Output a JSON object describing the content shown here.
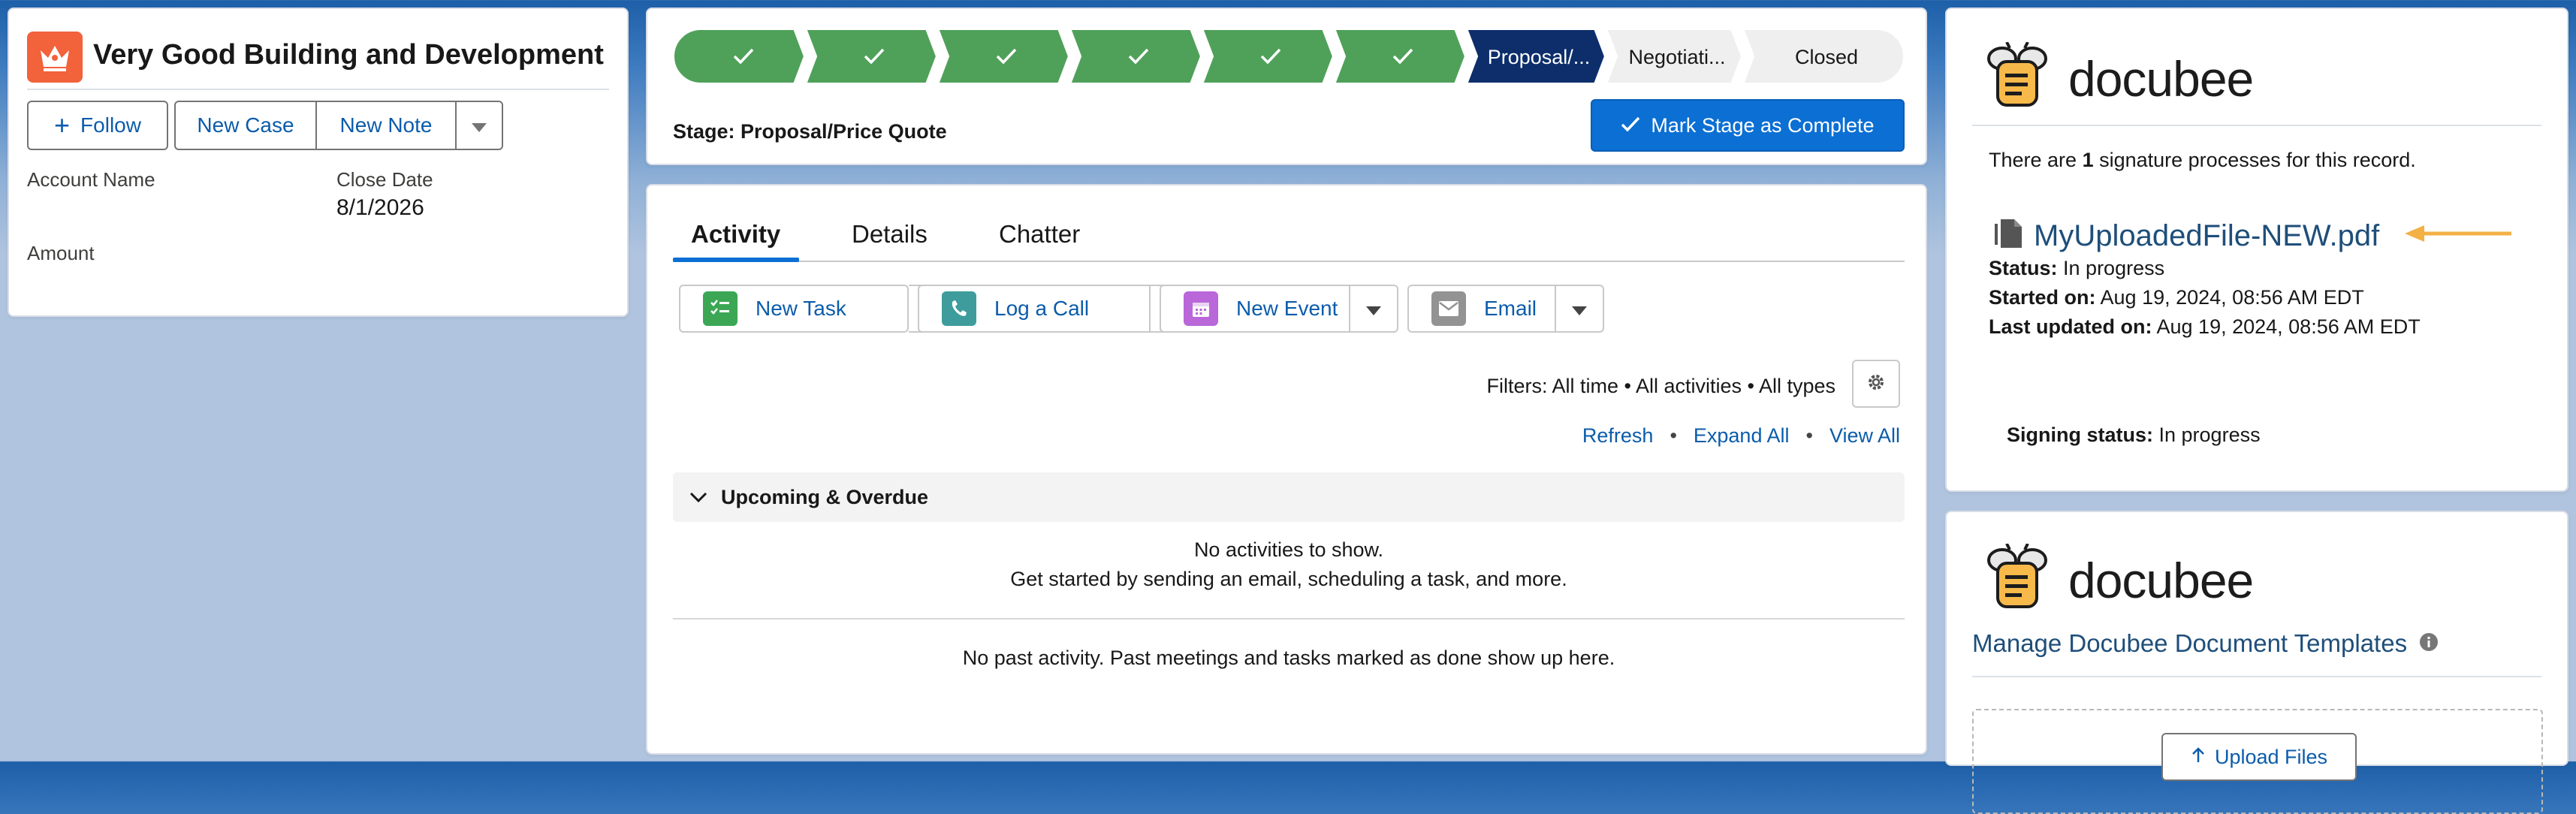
{
  "record": {
    "title": "Very Good Building and Development",
    "follow_label": "Follow",
    "new_case_label": "New Case",
    "new_note_label": "New Note",
    "fields": {
      "account_name_label": "Account Name",
      "close_date_label": "Close Date",
      "close_date_value": "8/1/2026",
      "amount_label": "Amount"
    }
  },
  "path": {
    "stages": [
      {
        "label": "",
        "status": "complete"
      },
      {
        "label": "",
        "status": "complete"
      },
      {
        "label": "",
        "status": "complete"
      },
      {
        "label": "",
        "status": "complete"
      },
      {
        "label": "",
        "status": "complete"
      },
      {
        "label": "",
        "status": "complete"
      },
      {
        "label": "Proposal/...",
        "status": "current"
      },
      {
        "label": "Negotiati...",
        "status": "incomplete"
      },
      {
        "label": "Closed",
        "status": "incomplete"
      }
    ],
    "stage_text": "Stage: Proposal/Price Quote",
    "mark_complete_label": "Mark Stage as Complete",
    "colors": {
      "complete": "#4fa15a",
      "current": "#0d2e6b",
      "incomplete": "#efefef"
    }
  },
  "tabs": {
    "items": [
      "Activity",
      "Details",
      "Chatter"
    ],
    "active": "Activity"
  },
  "activity": {
    "buttons": {
      "new_task": "New Task",
      "log_call": "Log a Call",
      "new_event": "New Event",
      "email": "Email"
    },
    "filters": "Filters: All time • All activities • All types",
    "links": {
      "refresh": "Refresh",
      "expand_all": "Expand All",
      "view_all": "View All",
      "separator": "•"
    },
    "upcoming_header": "Upcoming & Overdue",
    "no_activities": "No activities to show.",
    "get_started": "Get started by sending an email, scheduling a task, and more.",
    "no_past": "No past activity. Past meetings and tasks marked as done show up here."
  },
  "docubee": {
    "logo_word": "docubee",
    "summary_prefix": "There are ",
    "summary_count": "1",
    "summary_suffix": " signature processes for this record.",
    "file_name": "MyUploadedFile-NEW.pdf",
    "status_label": "Status:",
    "status_value": "In progress",
    "started_label": "Started on:",
    "started_value": "Aug 19, 2024, 08:56 AM EDT",
    "updated_label": "Last updated on:",
    "updated_value": "Aug 19, 2024, 08:56 AM EDT",
    "signing_label": "Signing status:",
    "signing_value": "In progress",
    "manage_templates": "Manage Docubee Document Templates",
    "upload_label": "Upload Files"
  }
}
